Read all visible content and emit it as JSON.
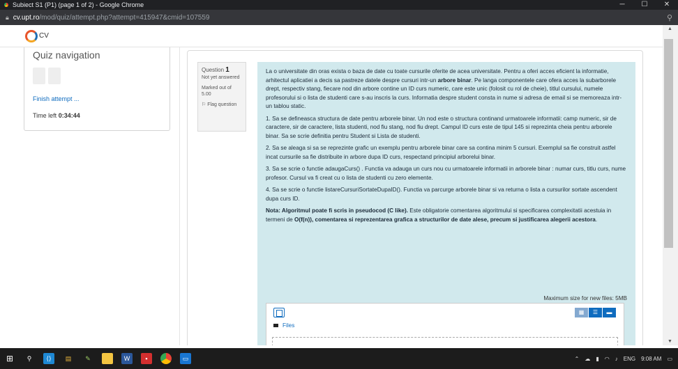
{
  "window": {
    "title": "Subiect S1 (P1) (page 1 of 2) - Google Chrome",
    "min": "─",
    "max": "☐",
    "close": "✕"
  },
  "address": {
    "host": "cv.upt.ro",
    "path": "/mod/quiz/attempt.php?attempt=415947&cmid=107559",
    "zoom_icon": "search-icon"
  },
  "site": {
    "logo_text": "CV"
  },
  "quiznav": {
    "title": "Quiz navigation",
    "finish": "Finish attempt ...",
    "time_label": "Time left ",
    "time_value": "0:34:44"
  },
  "question": {
    "label": "Question ",
    "number": "1",
    "status": "Not yet answered",
    "marked": "Marked out of 5.00",
    "flag": "Flag question",
    "intro_pre": "La o universitate din oras exista o baza de date cu toate cursurile oferite de acea universitate. Pentru a oferi acces eficient la informatie, arhitectul aplicatiei a decis sa pastreze datele despre cursuri intr-un ",
    "intro_bold": "arbore binar",
    "intro_post": ". Pe langa componentele care ofera acces la subarborele drept, respectiv stang, fiecare nod din arbore contine un ID curs numeric, care este unic (folosit cu rol de cheie), titlul cursului, numele profesorului si o lista de studenti care s-au inscris la curs. Informatia despre student consta in nume si adresa de email si se memoreaza intr-un tablou static.",
    "items": [
      "1. Sa se defineasca structura de date pentru arborele binar. Un nod este o structura continand urmatoarele informatii: camp numeric, sir de caractere, sir de caractere, lista studenti, nod fiu stang, nod fiu drept. Campul ID curs este de tipul 145 si reprezinta cheia pentru arborele binar. Sa se scrie definitia pentru Student si Lista de studenti.",
      "2. Sa se aleaga si sa se reprezinte grafic un exemplu pentru arborele binar care sa contina minim 5 cursuri. Exemplul sa fie construit astfel incat cursurile sa fie distribuite in arbore dupa ID curs, respectand principiul arborelui binar.",
      "3. Sa se scrie o functie adaugaCurs() . Functia va adauga un curs nou cu urmatoarele informatii in arborele binar : numar curs, titlu curs, nume profesor. Cursul va fi creat cu o lista de studenti cu zero elemente.",
      "4. Sa se scrie o functie listareCursuriSortateDupaID(). Functia va parcurge arborele binar si va returna o lista a cursurilor sortate ascendent dupa curs ID."
    ],
    "note_label": "Nota",
    "note_b1": ": Algoritmul poate fi scris in pseudocod (C like).",
    "note_t1": " Este obligatorie comentarea algoritmului si specificarea complexitatii acestuia in termeni de ",
    "note_b2": "O(f(n)), comentarea si reprezentarea grafica a structurilor de date alese, precum si justificarea alegerii acestora",
    "note_end": ".",
    "max_size": "Maximum size for new files: 5MB",
    "files_label": "Files"
  },
  "taskbar": {
    "lang": "ENG",
    "time": "9:08 AM"
  }
}
